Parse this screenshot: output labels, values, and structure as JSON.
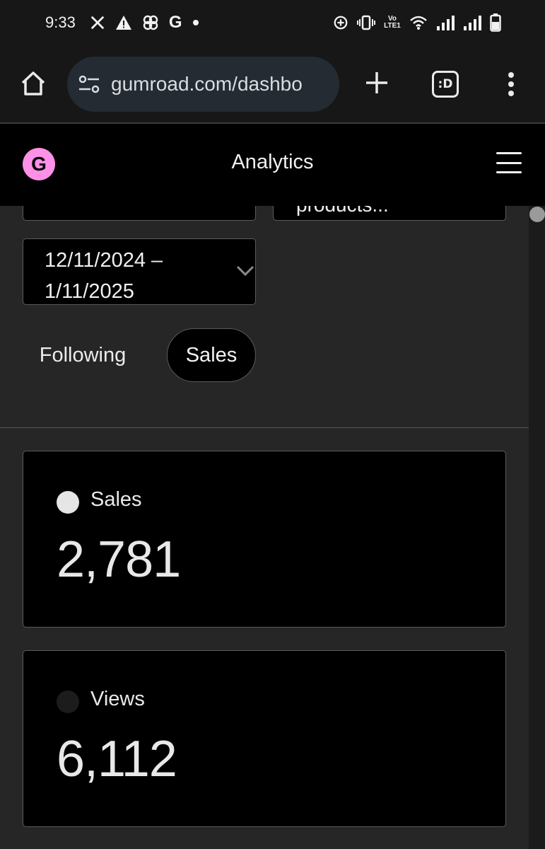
{
  "status_bar": {
    "time": "9:33",
    "left_icons": [
      "x-logo-icon",
      "warning-triangle-icon",
      "pinwheel-icon",
      "google-g-icon",
      "dot-icon"
    ],
    "right_icons": [
      "data-saver-icon",
      "vibrate-icon",
      "volte-icon",
      "wifi-icon",
      "signal-icon",
      "signal-icon",
      "battery-icon"
    ],
    "google_letter": "G",
    "volte_text": "Vo LTE1"
  },
  "browser": {
    "url": "gumroad.com/dashbo",
    "tabs_label": ":D",
    "icons": [
      "home-icon",
      "site-settings-icon",
      "new-tab-icon",
      "tab-switcher-icon",
      "more-vert-icon"
    ]
  },
  "app": {
    "logo_letter": "G",
    "title": "Analytics",
    "brand_color": "#ff90e8"
  },
  "filters": {
    "products_partial": "products...",
    "date_range": "12/11/2024 –\n1/11/2025"
  },
  "tabs": [
    {
      "label": "Following",
      "active": false
    },
    {
      "label": "Sales",
      "active": true
    }
  ],
  "cards": [
    {
      "label": "Sales",
      "value": "2,781",
      "dot_color": "#e5e5e5"
    },
    {
      "label": "Views",
      "value": "6,112",
      "dot_color": "#1c1c1c"
    }
  ]
}
